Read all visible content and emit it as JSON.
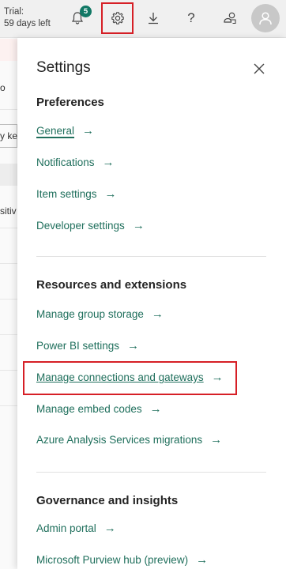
{
  "topbar": {
    "trial_label": "Trial:",
    "trial_days": "59 days left",
    "notification_count": "5",
    "help_glyph": "?",
    "icons": [
      "bell-icon",
      "gear-icon",
      "download-icon",
      "help-icon",
      "share-icon",
      "avatar-icon"
    ]
  },
  "background": {
    "frag_1": "o",
    "frag_2": "y ke",
    "frag_3": "sitiv"
  },
  "settings": {
    "title": "Settings",
    "sections": [
      {
        "heading": "Preferences",
        "links": [
          "General",
          "Notifications",
          "Item settings",
          "Developer settings"
        ]
      },
      {
        "heading": "Resources and extensions",
        "links": [
          "Manage group storage",
          "Power BI settings",
          "Manage connections and gateways",
          "Manage embed codes",
          "Azure Analysis Services migrations"
        ]
      },
      {
        "heading": "Governance and insights",
        "links": [
          "Admin portal",
          "Microsoft Purview hub (preview)"
        ]
      }
    ],
    "arrow": "→"
  },
  "colors": {
    "accent_link": "#1f6f5c",
    "badge": "#117865",
    "highlight": "#d61f26"
  }
}
